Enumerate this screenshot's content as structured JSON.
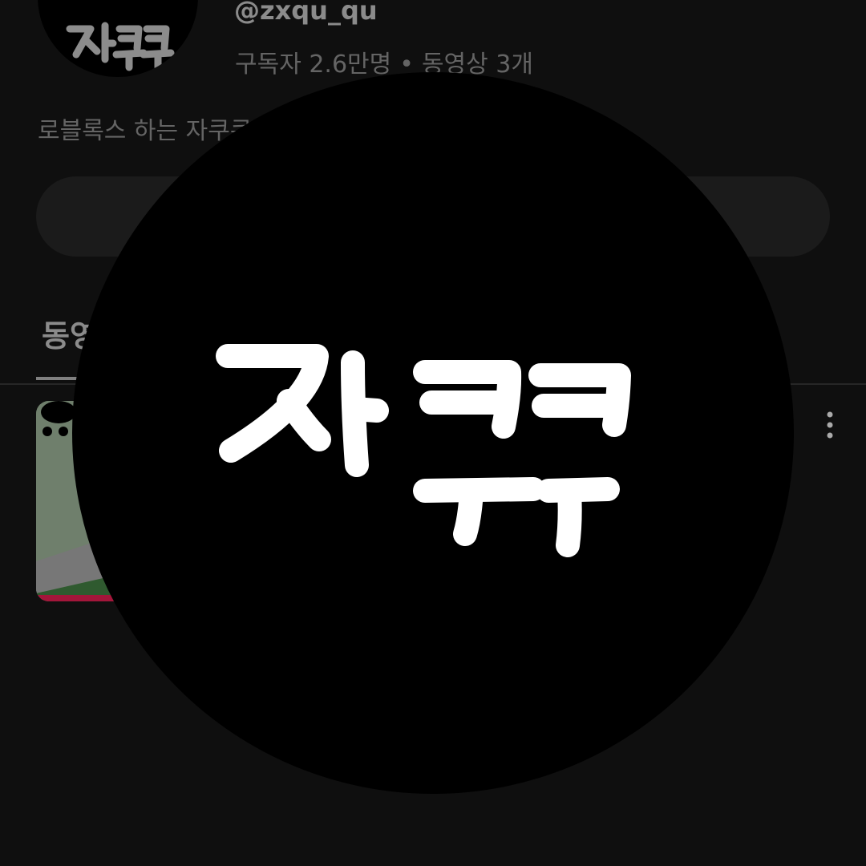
{
  "channel": {
    "handle": "@zxqu_qu",
    "subscribers": "구독자 2.6만명",
    "separator": "•",
    "video_count": "동영상 3개",
    "description": "로블록스 하는 자쿠쿠"
  },
  "tabs": [
    {
      "label": "동영상",
      "selected": true
    }
  ],
  "video_list": [
    {
      "thumbnail": "roblox-game-thumbnail",
      "menu_icon": "more-vert-icon"
    }
  ],
  "avatar": {
    "logo_text": "자쿠쿠",
    "background": "#000000",
    "stroke_color": "#ffffff"
  },
  "colors": {
    "page_background": "#0f0f0f",
    "button_background": "#1b1b1b",
    "secondary_text": "#aaaaaa"
  }
}
